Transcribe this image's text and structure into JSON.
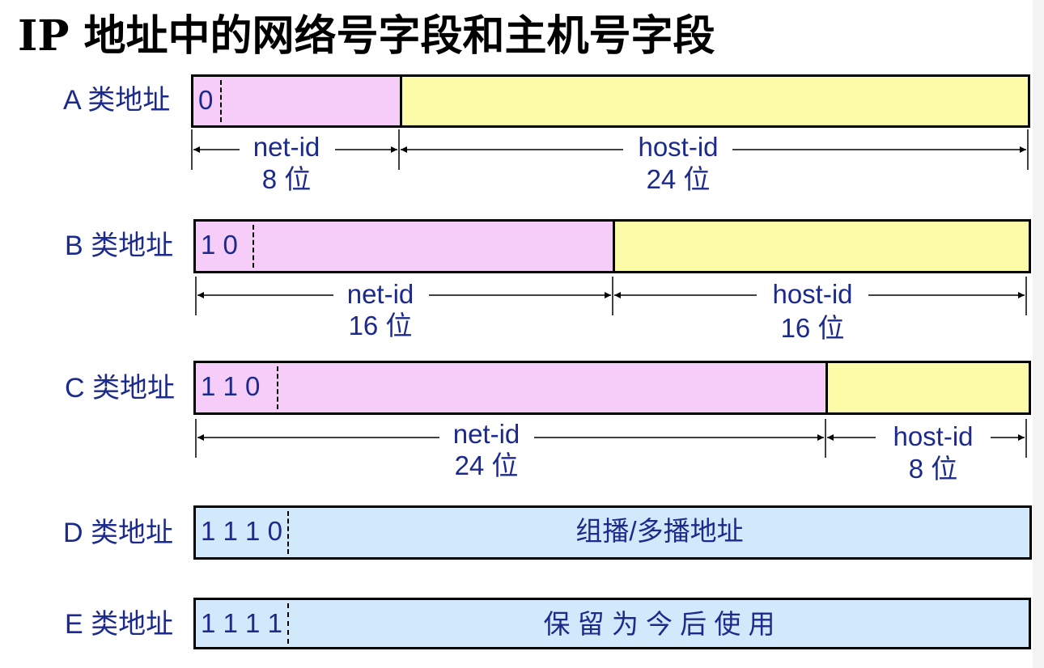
{
  "title": "IP 地址中的网络号字段和主机号字段",
  "classes": [
    {
      "label": "A 类地址",
      "prefix": "0",
      "net_field": "net-id",
      "net_bits": "8 位",
      "host_field": "host-id",
      "host_bits": "24 位"
    },
    {
      "label": "B 类地址",
      "prefix": "1 0",
      "net_field": "net-id",
      "net_bits": "16 位",
      "host_field": "host-id",
      "host_bits": "16 位"
    },
    {
      "label": "C 类地址",
      "prefix": "1 1 0",
      "net_field": "net-id",
      "net_bits": "24 位",
      "host_field": "host-id",
      "host_bits": "8 位"
    },
    {
      "label": "D 类地址",
      "prefix": "1 1 1 0",
      "field_text": "组播/多播地址"
    },
    {
      "label": "E 类地址",
      "prefix": "1 1 1 1",
      "field_text": "保 留 为 今 后 使 用"
    }
  ],
  "colors": {
    "net_fill": "#f5cdf8",
    "host_fill": "#fcfca8",
    "special_fill": "#d2e8fb",
    "label_text": "#1b2a8c"
  }
}
